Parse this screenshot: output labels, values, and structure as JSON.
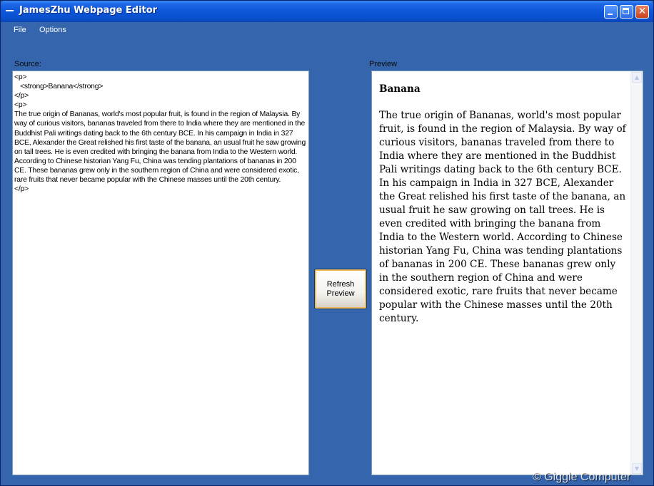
{
  "window": {
    "title": "JamesZhu Webpage Editor"
  },
  "menu": {
    "file": "File",
    "options": "Options"
  },
  "labels": {
    "source": "Source:",
    "preview": "Preview"
  },
  "source": {
    "value": "<p>\n   <strong>Banana</strong>\n</p>\n<p>\nThe true origin of Bananas, world's most popular fruit, is found in the region of Malaysia. By way of curious visitors, bananas traveled from there to India where they are mentioned in the Buddhist Pali writings dating back to the 6th century BCE. In his campaign in India in 327 BCE, Alexander the Great relished his first taste of the banana, an usual fruit he saw growing on tall trees. He is even credited with bringing the banana from India to the Western world. According to Chinese historian Yang Fu, China was tending plantations of bananas in 200 CE. These bananas grew only in the southern region of China and were considered exotic, rare fruits that never became popular with the Chinese masses until the 20th century.\n</p>"
  },
  "buttons": {
    "refresh_preview": "Refresh Preview"
  },
  "preview": {
    "heading": "Banana",
    "paragraph": "The true origin of Bananas, world's most popular fruit, is found in the region of Malaysia. By way of curious visitors, bananas traveled from there to India where they are mentioned in the Buddhist Pali writings dating back to the 6th century BCE. In his campaign in India in 327 BCE, Alexander the Great relished his first taste of the banana, an usual fruit he saw growing on tall trees. He is even credited with bringing the banana from India to the Western world. According to Chinese historian Yang Fu, China was tending plantations of bananas in 200 CE. These bananas grew only in the southern region of China and were considered exotic, rare fruits that never became popular with the Chinese masses until the 20th century."
  },
  "watermark": "© Giggle Computer",
  "icons": {
    "system_menu": "system-menu-icon",
    "minimize": "minimize-icon",
    "maximize": "maximize-icon",
    "close": "close-icon",
    "scroll_up": "scroll-up-arrow-icon",
    "scroll_down": "scroll-down-arrow-icon"
  },
  "colors": {
    "window_background": "#3565AD",
    "titlebar": "#0C56D9",
    "button_focus": "#F2B65D"
  }
}
